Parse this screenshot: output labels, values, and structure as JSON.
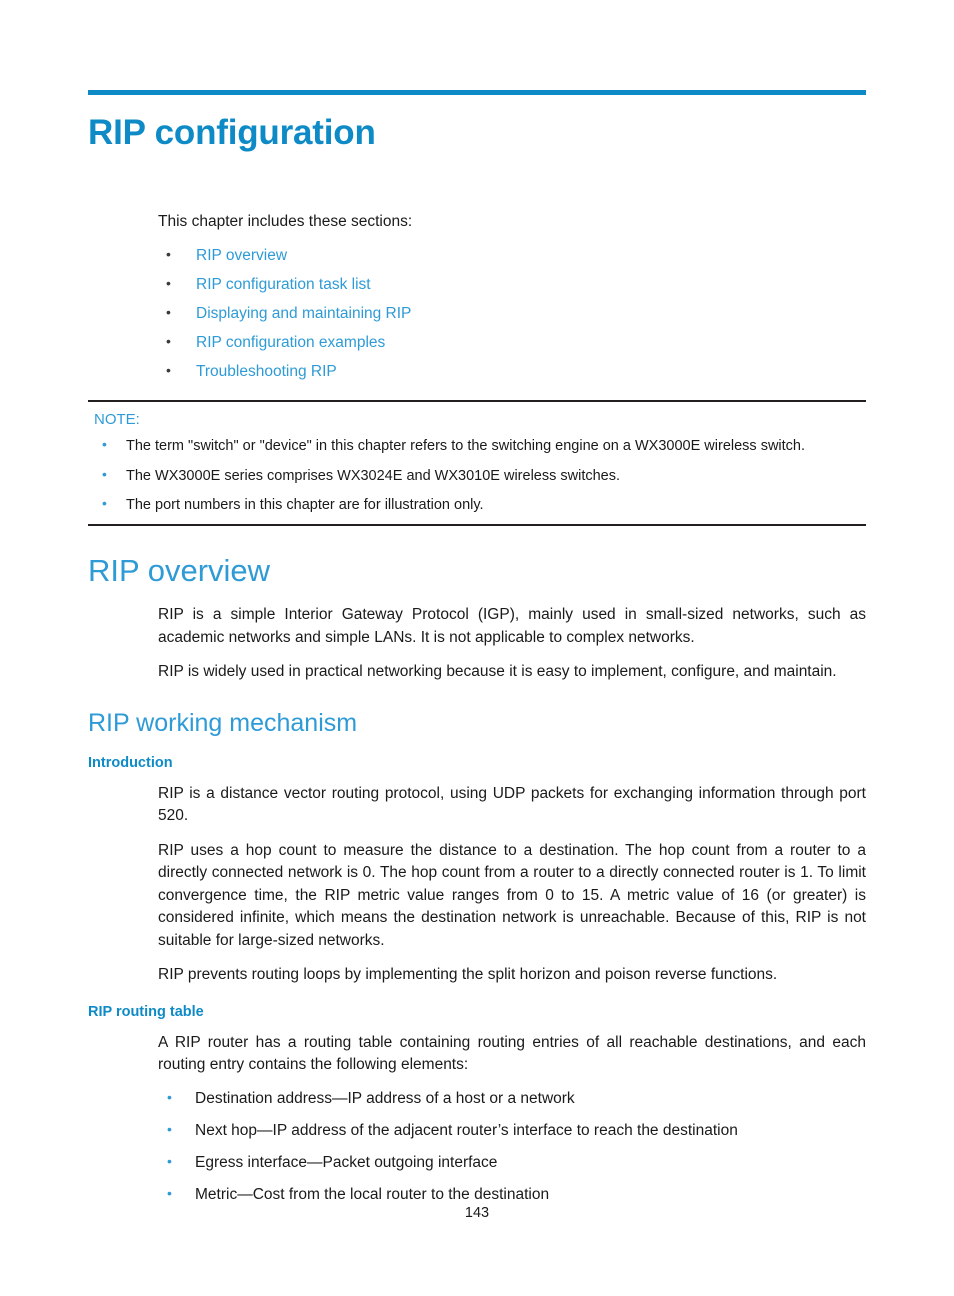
{
  "document": {
    "chapter_title": "RIP configuration",
    "page_number": "143",
    "accent_color": "#0e8bc6",
    "link_color": "#2e9bd6"
  },
  "intro": {
    "lead": "This chapter includes these sections:",
    "sections": [
      {
        "label": "RIP overview"
      },
      {
        "label": "RIP configuration task list"
      },
      {
        "label": "Displaying and maintaining RIP"
      },
      {
        "label": "RIP configuration examples"
      },
      {
        "label": "Troubleshooting RIP"
      }
    ]
  },
  "note": {
    "label": "NOTE:",
    "items": [
      {
        "text": "The term \"switch\" or \"device\" in this chapter refers to the switching engine on a WX3000E wireless switch."
      },
      {
        "text": "The WX3000E series comprises WX3024E and WX3010E wireless switches."
      },
      {
        "text": "The port numbers in this chapter are for illustration only."
      }
    ]
  },
  "rip_overview": {
    "heading": "RIP overview",
    "paragraphs": [
      {
        "text": "RIP is a simple Interior Gateway Protocol (IGP), mainly used in small-sized networks, such as academic networks and simple LANs. It is not applicable to complex networks."
      },
      {
        "text": "RIP is widely used in practical networking because it is easy to implement, configure, and maintain."
      }
    ]
  },
  "working_mechanism": {
    "heading": "RIP working mechanism",
    "introduction": {
      "heading": "Introduction",
      "paragraphs": [
        {
          "text": "RIP is a distance vector routing protocol, using UDP packets for exchanging information through port 520."
        },
        {
          "text": "RIP uses a hop count to measure the distance to a destination. The hop count from a router to a directly connected network is 0. The hop count from a router to a directly connected router is 1. To limit convergence time, the RIP metric value ranges from 0 to 15. A metric value of 16 (or greater) is considered infinite, which means the destination network is unreachable. Because of this, RIP is not suitable for large-sized networks."
        },
        {
          "text": "RIP prevents routing loops by implementing the split horizon and poison reverse functions."
        }
      ]
    },
    "routing_table": {
      "heading": "RIP routing table",
      "intro": "A RIP router has a routing table containing routing entries of all reachable destinations, and each routing entry contains the following elements:",
      "elements": [
        {
          "text": "Destination address—IP address of a host or a network"
        },
        {
          "text": "Next hop—IP address of the adjacent router’s interface to reach the destination"
        },
        {
          "text": "Egress interface—Packet outgoing interface"
        },
        {
          "text": "Metric—Cost from the local router to the destination"
        }
      ]
    }
  }
}
